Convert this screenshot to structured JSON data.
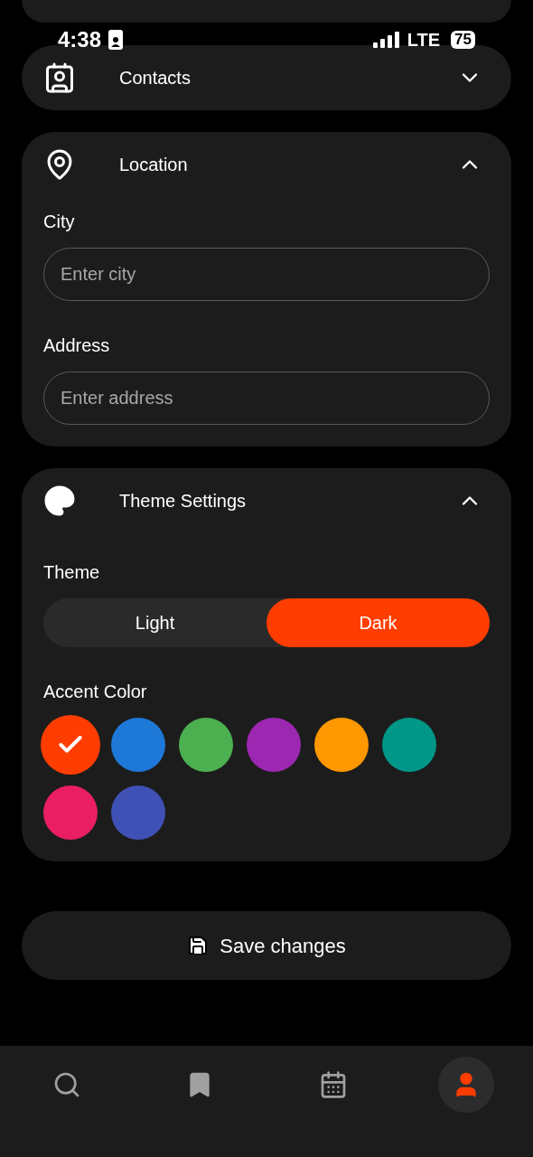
{
  "status_bar": {
    "time": "4:38",
    "network": "LTE",
    "battery": "75"
  },
  "sections": [
    {
      "kind": "contacts",
      "title": "Contacts",
      "expanded": false
    },
    {
      "kind": "location",
      "title": "Location",
      "expanded": true,
      "fields": [
        {
          "label": "City",
          "placeholder": "Enter city"
        },
        {
          "label": "Address",
          "placeholder": "Enter address"
        }
      ]
    },
    {
      "kind": "theme",
      "title": "Theme Settings",
      "expanded": true,
      "theme_label": "Theme",
      "theme_options": [
        {
          "label": "Light",
          "selected": false
        },
        {
          "label": "Dark",
          "selected": true
        }
      ],
      "accent_label": "Accent Color",
      "accent_colors": [
        {
          "color": "#ff3d00",
          "selected": true
        },
        {
          "color": "#1e78d8",
          "selected": false
        },
        {
          "color": "#4caf50",
          "selected": false
        },
        {
          "color": "#9c27b0",
          "selected": false
        },
        {
          "color": "#ff9800",
          "selected": false
        },
        {
          "color": "#009688",
          "selected": false
        },
        {
          "color": "#e91e63",
          "selected": false
        },
        {
          "color": "#3f51b5",
          "selected": false
        }
      ]
    }
  ],
  "save_button": "Save changes",
  "nav": [
    {
      "kind": "search",
      "selected": false
    },
    {
      "kind": "bookmark",
      "selected": false
    },
    {
      "kind": "calendar",
      "selected": false
    },
    {
      "kind": "profile",
      "selected": true
    }
  ]
}
